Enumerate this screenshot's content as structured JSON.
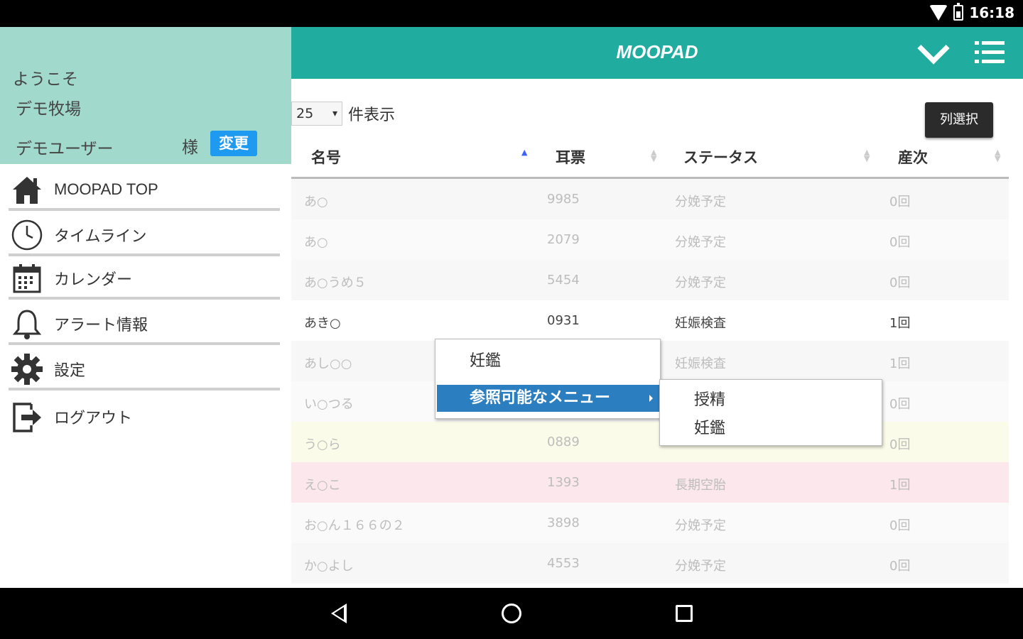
{
  "status_bar": {
    "time": "16:18"
  },
  "drawer": {
    "welcome": "ようこそ",
    "farm": "デモ牧場",
    "user": "デモユーザー",
    "honorific": "様",
    "change_label": "変更",
    "items": [
      {
        "label": "MOOPAD TOP",
        "icon": "home-icon"
      },
      {
        "label": "タイムライン",
        "icon": "clock-icon"
      },
      {
        "label": "カレンダー",
        "icon": "calendar-icon"
      },
      {
        "label": "アラート情報",
        "icon": "bell-icon"
      },
      {
        "label": "設定",
        "icon": "gear-icon"
      },
      {
        "label": "ログアウト",
        "icon": "logout-icon"
      }
    ]
  },
  "header": {
    "title": "MOOPAD"
  },
  "controls": {
    "page_size": "25",
    "page_size_label": "件表示",
    "column_select_label": "列選択"
  },
  "table": {
    "headers": [
      "名号",
      "耳票",
      "ステータス",
      "産次"
    ],
    "rows": [
      {
        "name": "あ○",
        "tag": "9985",
        "status": "分娩予定",
        "parity": "0回"
      },
      {
        "name": "あ○",
        "tag": "2079",
        "status": "分娩予定",
        "parity": "0回"
      },
      {
        "name": "あ○うめ５",
        "tag": "5454",
        "status": "分娩予定",
        "parity": "0回"
      },
      {
        "name": "あき○",
        "tag": "0931",
        "status": "妊娠検査",
        "parity": "1回"
      },
      {
        "name": "あし○○",
        "tag": "",
        "status": "妊娠検査",
        "parity": "1回"
      },
      {
        "name": "い○つる",
        "tag": "",
        "status": "",
        "parity": "0回"
      },
      {
        "name": "う○ら",
        "tag": "0889",
        "status": "",
        "parity": "0回"
      },
      {
        "name": "え○こ",
        "tag": "1393",
        "status": "長期空胎",
        "parity": "1回"
      },
      {
        "name": "お○ん１６６の２",
        "tag": "3898",
        "status": "分娩予定",
        "parity": "0回"
      },
      {
        "name": "か○よし",
        "tag": "4553",
        "status": "分娩予定",
        "parity": "0回"
      }
    ]
  },
  "context_menu": {
    "item1": "妊鑑",
    "item2": "参照可能なメニュー",
    "submenu": [
      "授精",
      "妊鑑"
    ]
  }
}
